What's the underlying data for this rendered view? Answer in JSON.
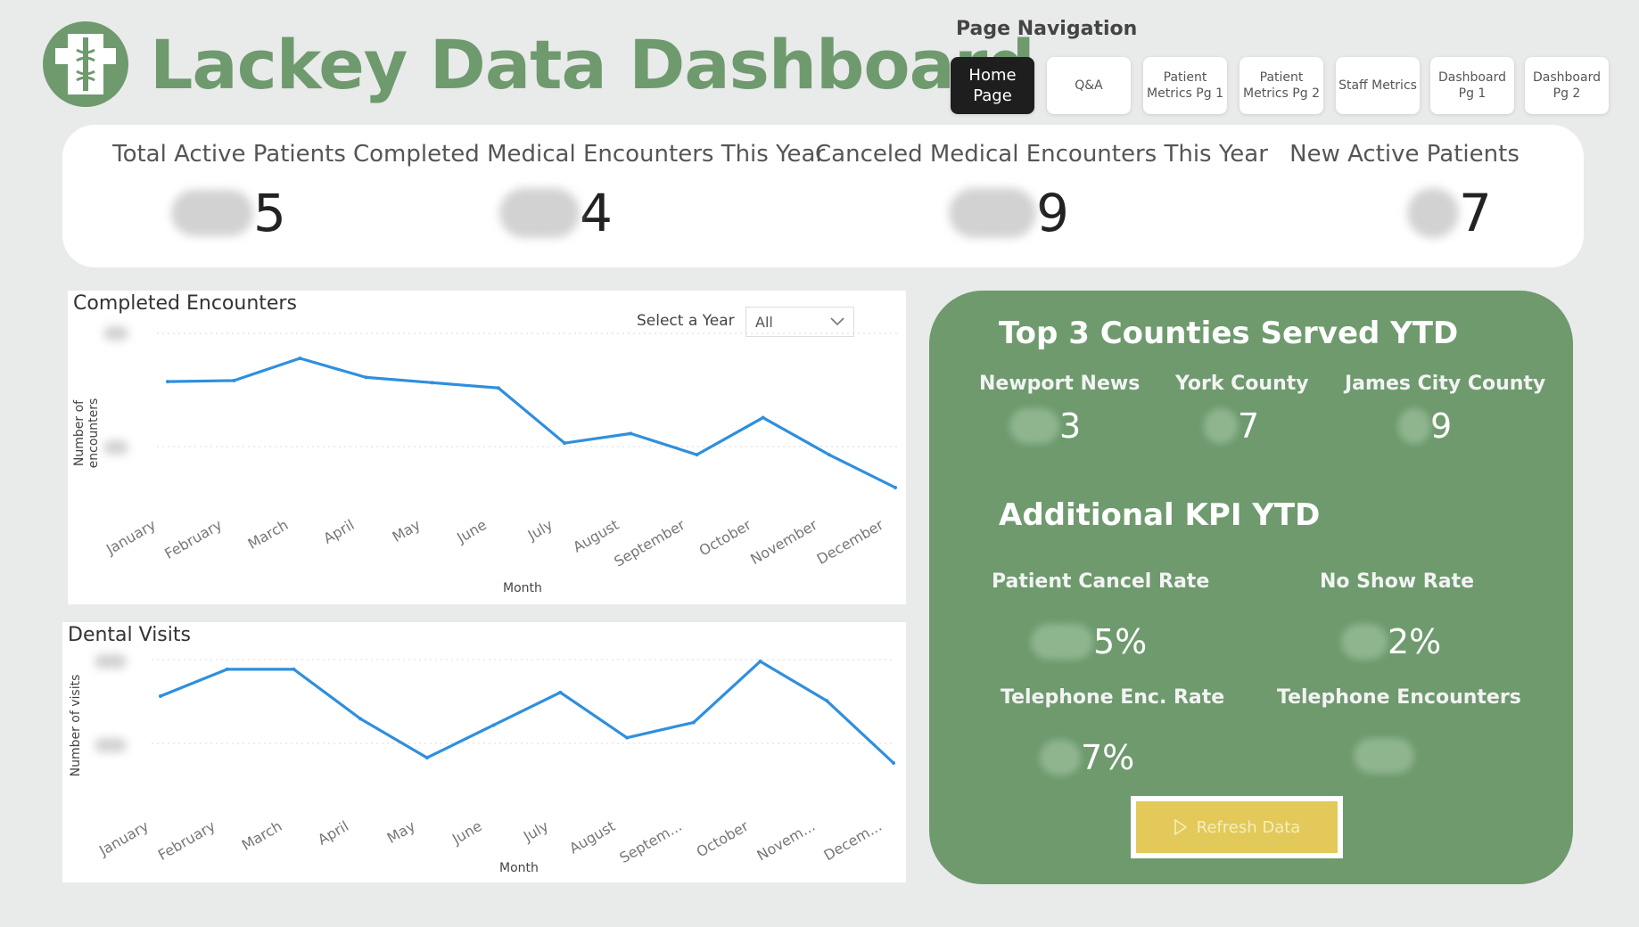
{
  "header": {
    "title": "Lackey Data Dashboard",
    "logo_icon": "caduceus-icon",
    "brand_color": "#6e9a6e"
  },
  "nav": {
    "title": "Page Navigation",
    "buttons": [
      {
        "l1": "Home",
        "l2": "Page",
        "active": true
      },
      {
        "l1": "Q&A",
        "l2": ""
      },
      {
        "l1": "Patient",
        "l2": "Metrics Pg 1"
      },
      {
        "l1": "Patient",
        "l2": "Metrics Pg 2"
      },
      {
        "l1": "Staff Metrics",
        "l2": ""
      },
      {
        "l1": "Dashboard",
        "l2": "Pg 1"
      },
      {
        "l1": "Dashboard",
        "l2": "Pg 2"
      }
    ]
  },
  "kpis": [
    {
      "label": "Total Active Patients",
      "value": "5"
    },
    {
      "label": "Completed Medical Encounters This Year",
      "value": "4"
    },
    {
      "label": "Canceled Medical Encounters This Year",
      "value": "9"
    },
    {
      "label": "New Active Patients",
      "value": "7"
    }
  ],
  "completed_chart": {
    "title": "Completed Encounters",
    "slicer_label": "Select a Year",
    "slicer_value": "All",
    "ylabel": "Number of encounters",
    "xlabel": "Month"
  },
  "dental_chart": {
    "title": "Dental Visits",
    "ylabel": "Number of visits",
    "xlabel": "Month"
  },
  "chart_data": [
    {
      "type": "line",
      "title": "Completed Encounters",
      "xlabel": "Month",
      "ylabel": "Number of encounters",
      "categories": [
        "January",
        "February",
        "March",
        "April",
        "May",
        "June",
        "July",
        "August",
        "September",
        "October",
        "November",
        "December"
      ],
      "values": [
        0.58,
        0.59,
        0.8,
        0.62,
        0.57,
        0.52,
        0.0,
        0.09,
        -0.11,
        0.24,
        -0.11,
        -0.42
      ],
      "line_color": "#2f8fdd"
    },
    {
      "type": "line",
      "title": "Dental Visits",
      "xlabel": "Month",
      "ylabel": "Number of visits",
      "categories": [
        "January",
        "February",
        "March",
        "April",
        "May",
        "June",
        "July",
        "August",
        "September",
        "October",
        "November",
        "December"
      ],
      "tick_labels": [
        "January",
        "February",
        "March",
        "April",
        "May",
        "June",
        "July",
        "August",
        "Septem...",
        "October",
        "Novem...",
        "Decem..."
      ],
      "values": [
        0.77,
        1.28,
        1.28,
        0.34,
        -0.4,
        0.22,
        0.84,
        -0.02,
        0.27,
        1.43,
        0.68,
        -0.5
      ],
      "line_color": "#2f8fdd"
    }
  ],
  "counties": {
    "title": "Top 3 Counties Served YTD",
    "items": [
      {
        "name": "Newport News",
        "value": "3"
      },
      {
        "name": "York County",
        "value": "7"
      },
      {
        "name": "James City County",
        "value": "9"
      }
    ]
  },
  "additional": {
    "title": "Additional KPI YTD",
    "items": [
      {
        "label": "Patient Cancel Rate",
        "value": "5%"
      },
      {
        "label": "No Show Rate",
        "value": "2%"
      },
      {
        "label": "Telephone Enc. Rate",
        "value": "7%"
      },
      {
        "label": "Telephone Encounters",
        "value": ""
      }
    ]
  },
  "refresh": {
    "label": "Refresh Data",
    "icon": "play-icon",
    "color": "#e2c95a"
  }
}
